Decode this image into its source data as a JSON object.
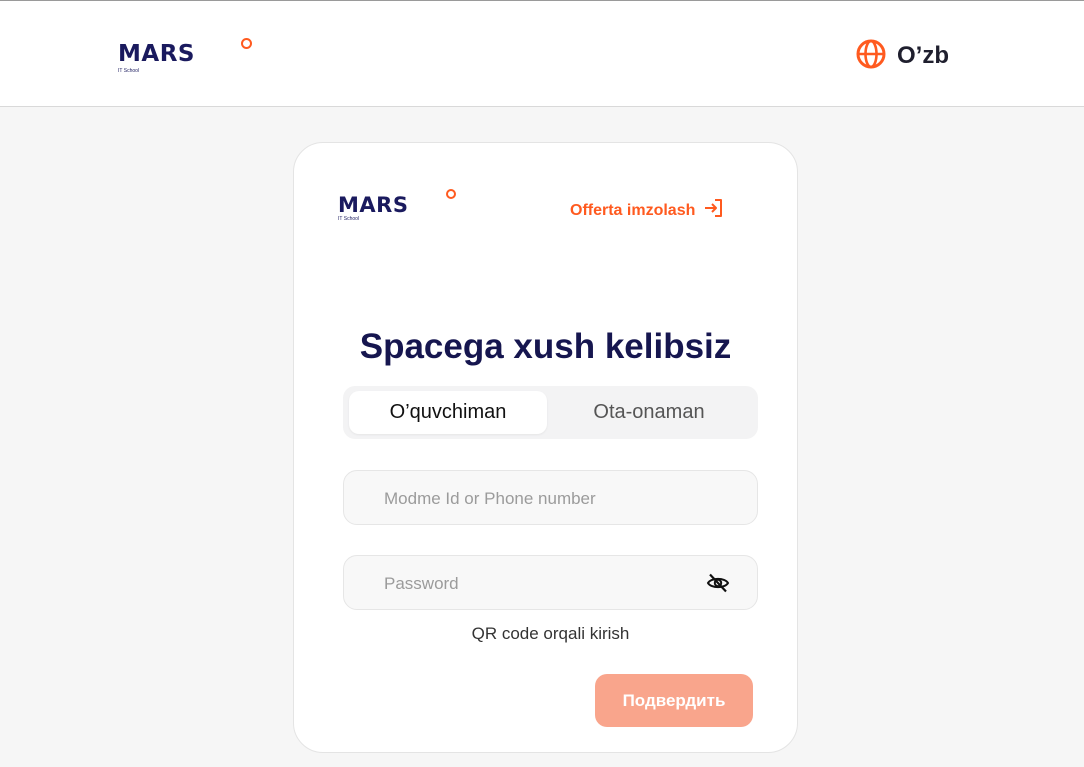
{
  "header": {
    "logo": {
      "word": "MARS",
      "sub": "IT School"
    },
    "language": {
      "icon": "globe-icon",
      "label": "O’zb"
    }
  },
  "card": {
    "logo": {
      "word": "MARS",
      "sub": "IT School"
    },
    "offerta": {
      "label": "Offerta imzolash",
      "icon": "sign-in-icon"
    },
    "title": "Spacega xush kelibsiz",
    "tabs": [
      {
        "label": "O’quvchiman",
        "active": true
      },
      {
        "label": "Ota-onaman",
        "active": false
      }
    ],
    "login_field": {
      "placeholder": "Modme Id or Phone number",
      "value": ""
    },
    "password_field": {
      "placeholder": "Password",
      "value": "",
      "icon": "eye-off-icon"
    },
    "qr_link": "QR code orqali kirish",
    "submit_label": "Подвердить"
  },
  "colors": {
    "accent": "#ff5a1f",
    "brand": "#16164f",
    "submit_bg": "#f9a58c",
    "page_bg": "#f6f6f6"
  }
}
